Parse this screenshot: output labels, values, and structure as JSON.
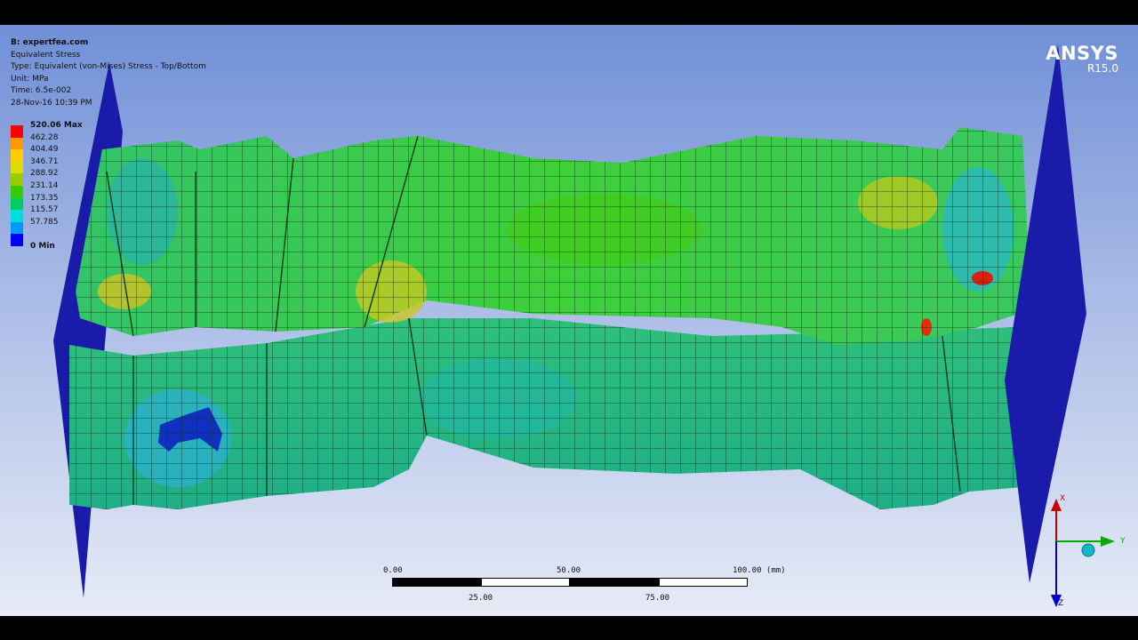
{
  "info": {
    "system": "B: expertfea.com",
    "result": "Equivalent Stress",
    "type": "Type: Equivalent (von-Mises) Stress - Top/Bottom",
    "unit": "Unit: MPa",
    "time": "Time: 6.5e-002",
    "date": "28-Nov-16 10:39 PM"
  },
  "legend": {
    "levels": [
      {
        "label": "520.06 Max",
        "color": "#ff0000",
        "bold": true
      },
      {
        "label": "462.28",
        "color": "#ff9900",
        "bold": false
      },
      {
        "label": "404.49",
        "color": "#ffcc00",
        "bold": false
      },
      {
        "label": "346.71",
        "color": "#dddd00",
        "bold": false
      },
      {
        "label": "288.92",
        "color": "#99cc00",
        "bold": false
      },
      {
        "label": "231.14",
        "color": "#33cc00",
        "bold": false
      },
      {
        "label": "173.35",
        "color": "#00cc66",
        "bold": false
      },
      {
        "label": "115.57",
        "color": "#00dddd",
        "bold": false
      },
      {
        "label": "57.785",
        "color": "#0099ff",
        "bold": false
      },
      {
        "label": "",
        "color": "#0000ff",
        "bold": false
      }
    ],
    "min_label": "0 Min"
  },
  "brand": {
    "name": "ANSYS",
    "version": "R15.0"
  },
  "scalebar": {
    "top_labels": [
      "0.00",
      "50.00",
      "100.00 (mm)"
    ],
    "bottom_labels": [
      "25.00",
      "75.00"
    ]
  },
  "triad": {
    "x": "X",
    "y": "Y",
    "z": "Z"
  },
  "colors": {
    "plate": "#1a1aa8",
    "mesh_line": "#123018",
    "triad_x": "#cc0000",
    "triad_y": "#00aa00",
    "triad_z": "#0000cc"
  }
}
